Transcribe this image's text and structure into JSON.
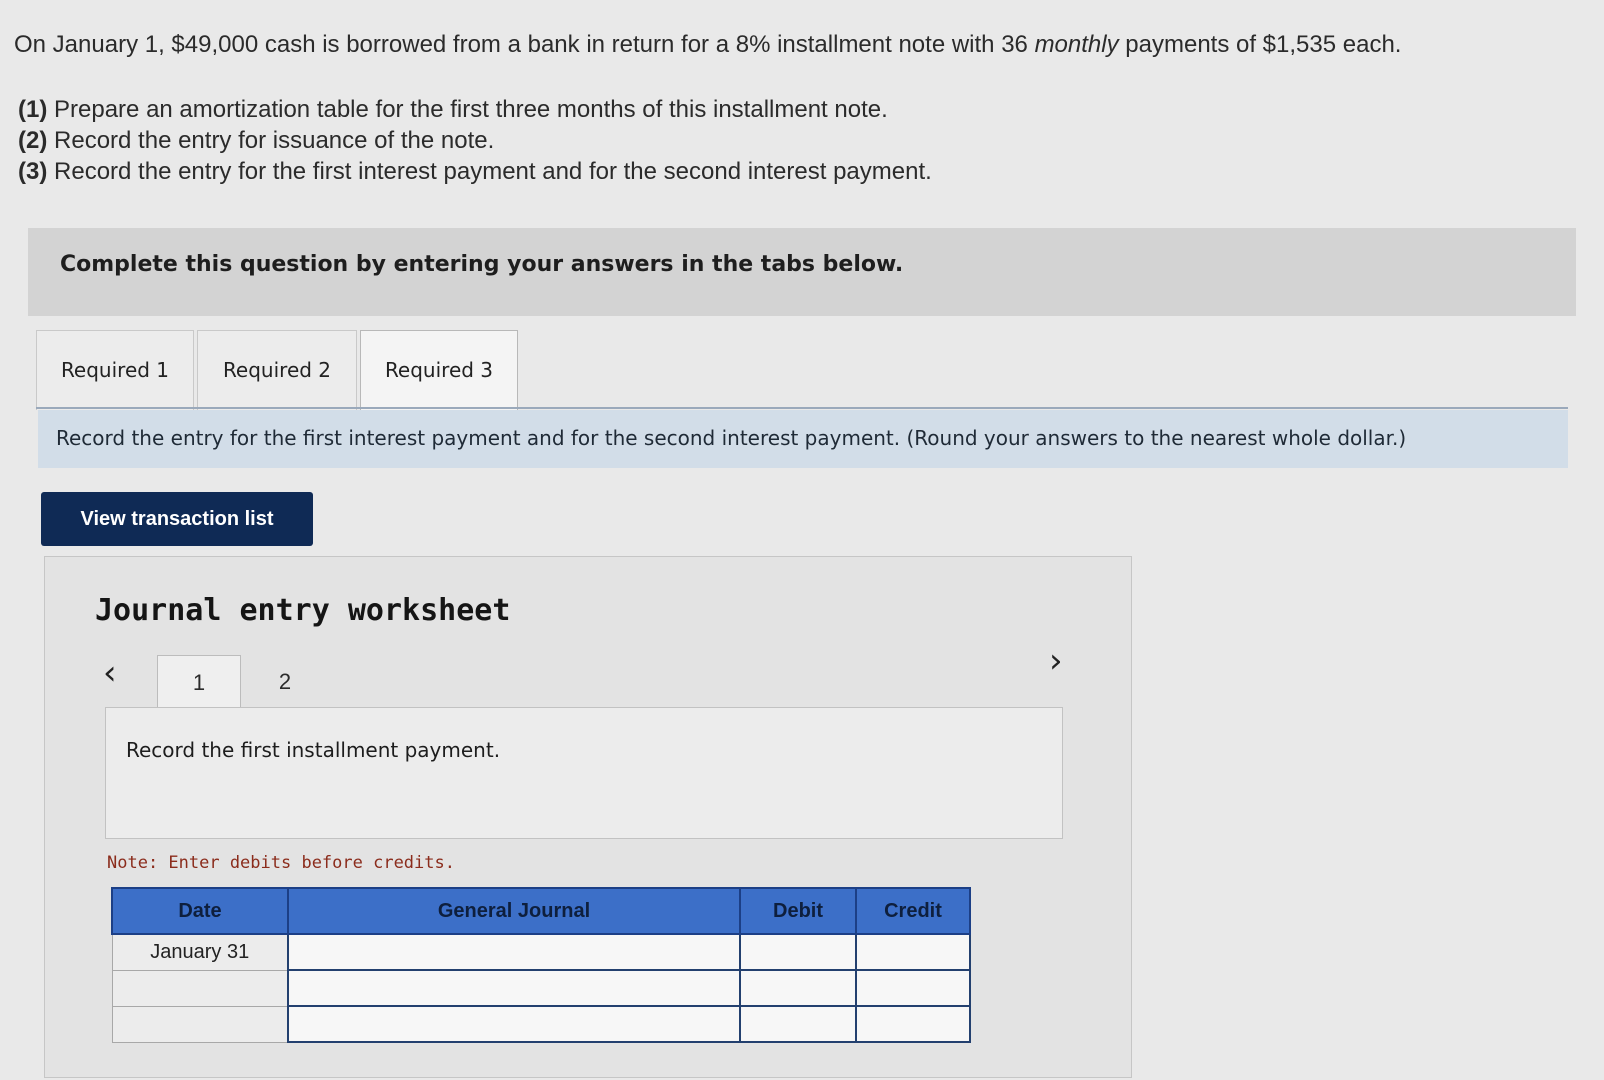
{
  "problem": {
    "text_before": "On January 1, $49,000 cash is borrowed from a bank in return for a 8% installment note with 36 ",
    "emphasis": "monthly",
    "text_after": " payments of $1,535 each."
  },
  "requirements": [
    {
      "num": "(1)",
      "text": " Prepare an amortization table for the first three months of this installment note."
    },
    {
      "num": "(2)",
      "text": " Record the entry for issuance of the note."
    },
    {
      "num": "(3)",
      "text": " Record the entry for the first interest payment and for the second interest payment."
    }
  ],
  "banner": "Complete this question by entering your answers in the tabs below.",
  "tabs": [
    "Required 1",
    "Required 2",
    "Required 3"
  ],
  "active_tab": "Required 3",
  "instruction": "Record the entry for the first interest payment and for the second interest payment. (Round your answers to the nearest whole dollar.)",
  "view_button": "View transaction list",
  "worksheet": {
    "title": "Journal entry worksheet",
    "prev_icon": "‹",
    "next_icon": "›",
    "pages": [
      "1",
      "2"
    ],
    "active_page": "1",
    "task": "Record the first installment payment.",
    "note": "Note: Enter debits before credits.",
    "columns": [
      "Date",
      "General Journal",
      "Debit",
      "Credit"
    ],
    "rows": [
      {
        "date": "January 31"
      },
      {
        "date": ""
      },
      {
        "date": ""
      }
    ]
  },
  "colors": {
    "header_blue": "#3c6fc8",
    "button_navy": "#0f2a55",
    "instruction_bg": "#d2dde8"
  }
}
